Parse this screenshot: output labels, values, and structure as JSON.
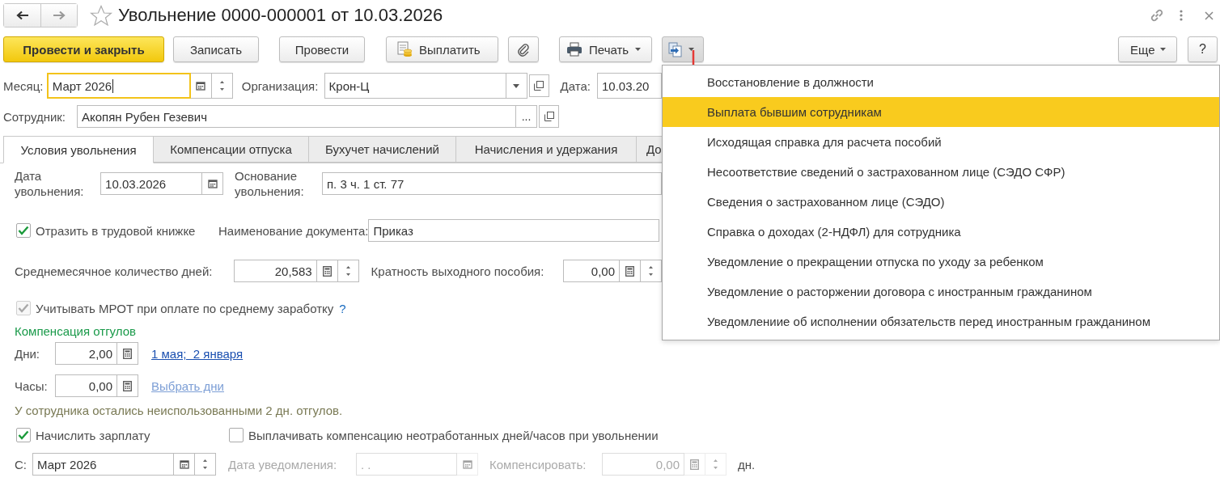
{
  "window": {
    "title": "Увольнение 0000-000001 от 10.03.2026"
  },
  "toolbar": {
    "buttons": [
      {
        "label": "Провести и закрыть",
        "kind": "default"
      },
      {
        "label": "Записать",
        "kind": "plain"
      },
      {
        "label": "Провести",
        "kind": "plain"
      },
      {
        "label": "Выплатить",
        "kind": "pay"
      },
      {
        "kind": "attach"
      },
      {
        "label": "Печать",
        "kind": "print"
      },
      {
        "kind": "create",
        "expanded": true
      }
    ],
    "more": "Еще",
    "help": "?"
  },
  "month": {
    "label": "Месяц:",
    "value": "Март 2026",
    "focused": true
  },
  "organization": {
    "label": "Организация:",
    "value": "Крон-Ц"
  },
  "date": {
    "label": "Дата:",
    "value": "10.03.20"
  },
  "employee": {
    "label": "Сотрудник:",
    "value": "Акопян Рубен Гезевич",
    "select_button": "..."
  },
  "tabs": [
    {
      "label": "Условия увольнения",
      "selected": true
    },
    {
      "label": "Компенсации отпуска",
      "selected": false
    },
    {
      "label": "Бухучет начислений",
      "selected": false
    },
    {
      "label": "Начисления и удержания",
      "selected": false
    },
    {
      "label": "До",
      "selected": false
    }
  ],
  "dismissal_date": {
    "label": "Дата увольнения:",
    "value": "10.03.2026"
  },
  "reason": {
    "label": "Основание увольнения:",
    "value": "п. 3 ч. 1 ст. 77"
  },
  "record_in_workbook": {
    "label": "Отразить в трудовой книжке",
    "checked": true
  },
  "document_name": {
    "label": "Наименование документа:",
    "value": "Приказ"
  },
  "avg_days": {
    "label": "Среднемесячное количество дней:",
    "value": "20,583"
  },
  "severance_multiplier": {
    "label": "Кратность выходного пособия:",
    "value": "0,00"
  },
  "mrot": {
    "label": "Учитывать МРОТ при оплате по среднему заработку",
    "checked": true,
    "disabled": true,
    "help": "?"
  },
  "time_off_comp": {
    "title": "Компенсация отгулов",
    "days": {
      "label": "Дни:",
      "value": "2,00",
      "link": "1 мая;  2 января",
      "disabled": false
    },
    "hours": {
      "label": "Часы:",
      "value": "0,00",
      "link": "Выбрать дни",
      "disabled": true
    },
    "note": "У сотрудника остались неиспользованными 2 дн. отгулов."
  },
  "accrue_salary": {
    "label": "Начислить зарплату",
    "checked": true
  },
  "pay_comp": {
    "label": "Выплачивать компенсацию неотработанных дней/часов при увольнении",
    "checked": false
  },
  "from": {
    "label": "С:",
    "value": "Март 2026"
  },
  "notice_date": {
    "label": "Дата уведомления:",
    "placeholder": ". .",
    "disabled": true
  },
  "compensate": {
    "label": "Компенсировать:",
    "value": "0,00",
    "unit": "дн.",
    "disabled": true
  },
  "menu": {
    "items": [
      {
        "label": "Восстановление в должности",
        "selected": false
      },
      {
        "label": "Выплата бывшим сотрудникам",
        "selected": true
      },
      {
        "label": "Исходящая справка для расчета пособий",
        "selected": false
      },
      {
        "label": "Несоответствие сведений о застрахованном лице (СЭДО СФР)",
        "selected": false
      },
      {
        "label": "Сведения о застрахованном лице (СЭДО)",
        "selected": false
      },
      {
        "label": "Справка о доходах (2-НДФЛ) для сотрудника",
        "selected": false
      },
      {
        "label": "Уведомление о прекращении отпуска по уходу за ребенком",
        "selected": false
      },
      {
        "label": "Уведомление о расторжении договора с иностранным гражданином",
        "selected": false
      },
      {
        "label": "Уведомлениие об исполнении обязательств перед иностранным гражданином",
        "selected": false
      }
    ]
  }
}
